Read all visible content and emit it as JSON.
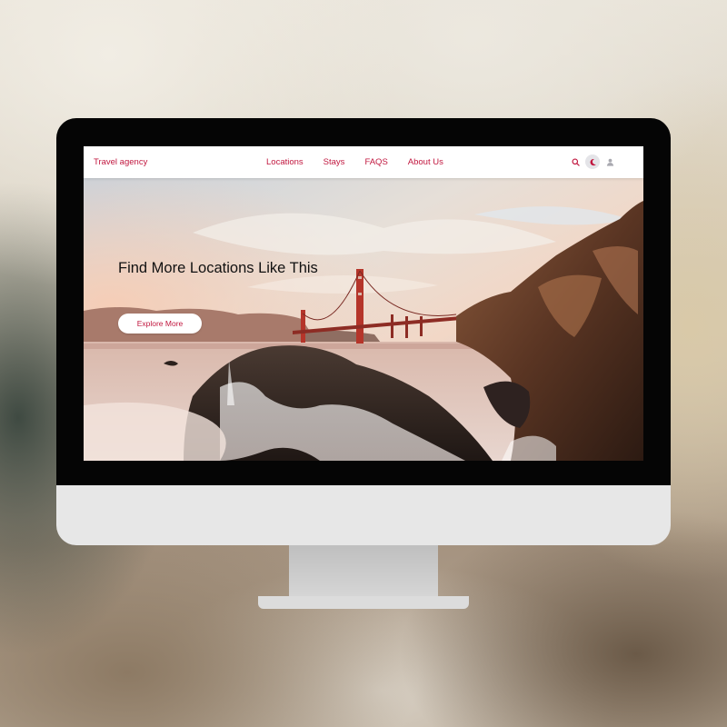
{
  "navbar": {
    "brand": "Travel agency",
    "links": [
      {
        "label": "Locations"
      },
      {
        "label": "Stays"
      },
      {
        "label": "FAQS"
      },
      {
        "label": "About Us"
      }
    ],
    "icons": [
      "search-icon",
      "moon-icon",
      "user-icon"
    ]
  },
  "hero": {
    "title": "Find More Locations Like This",
    "cta_label": "Explore More"
  },
  "colors": {
    "accent": "#c1173f",
    "bridge": "#b5352a",
    "monitor_frame": "#050505",
    "monitor_chin": "#e7e7e7"
  }
}
